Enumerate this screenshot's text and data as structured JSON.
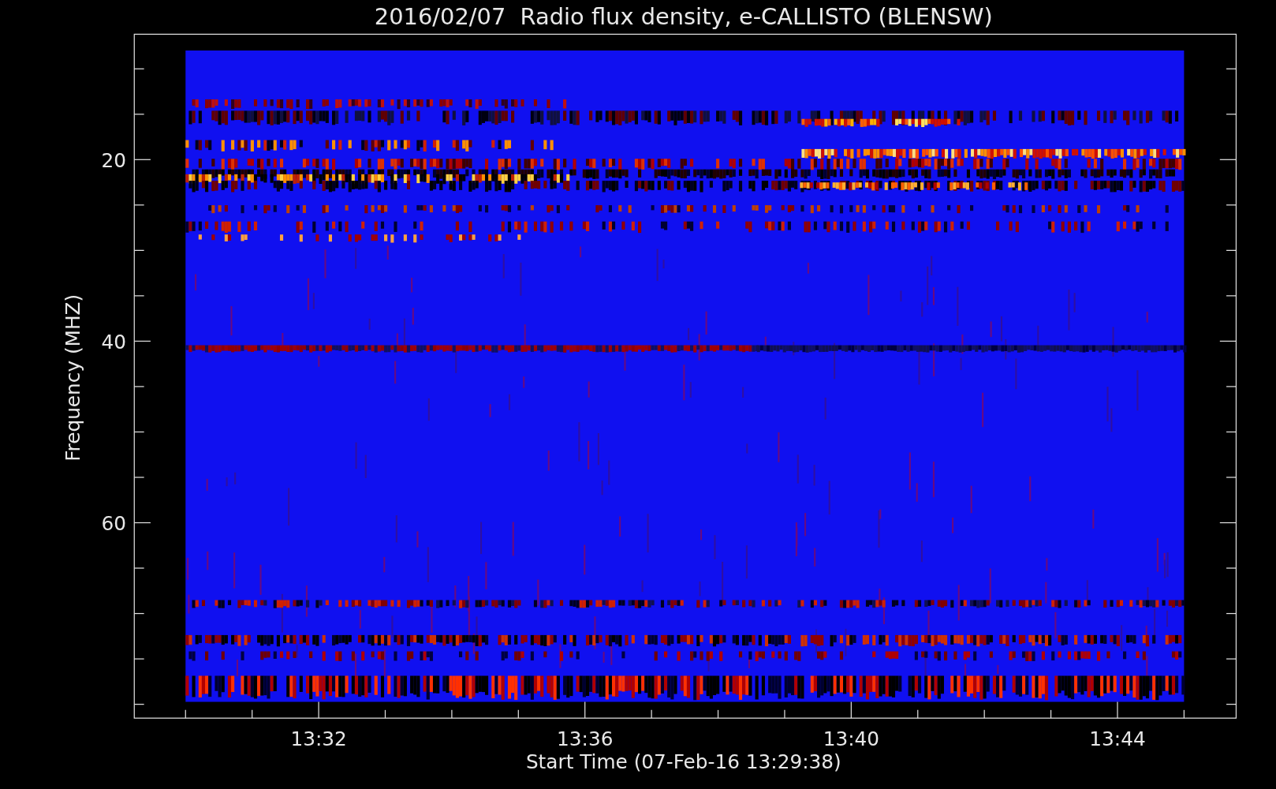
{
  "title": "2016/02/07  Radio flux density, e-CALLISTO (BLENSW)",
  "plot": {
    "ylabel": "Frequency (MHZ)",
    "xlabel": "Start Time (07-Feb-16 13:29:38)",
    "yticks": [
      "20",
      "40",
      "60"
    ],
    "xticks": [
      "13:32",
      "13:36",
      "13:40",
      "13:44"
    ]
  }
}
